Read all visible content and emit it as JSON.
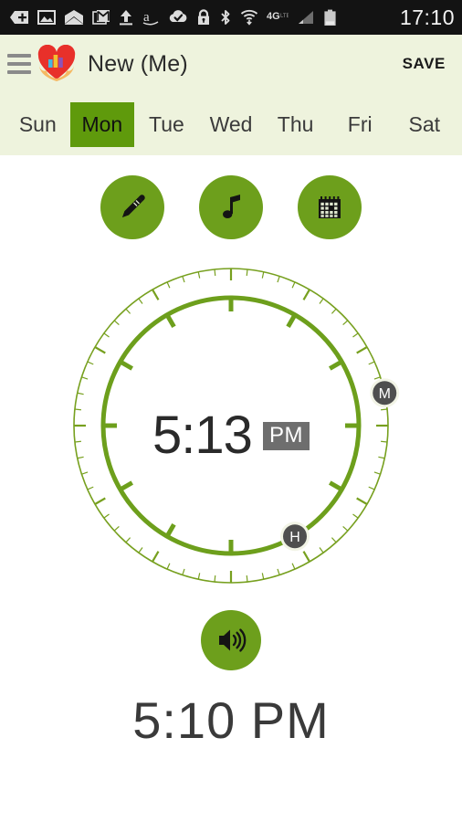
{
  "status_bar": {
    "time": "17:10",
    "network": "4G",
    "icons": [
      "add-tag-icon",
      "photo-icon",
      "envelope-icon",
      "gmail-icon",
      "upload-icon",
      "amazon-icon",
      "cloud-check-icon",
      "lock-icon",
      "bluetooth-icon",
      "wifi-icon",
      "signal-icon",
      "battery-icon"
    ]
  },
  "app_bar": {
    "menu_icon": "hamburger-menu-icon",
    "logo_icon": "heart-hands-logo",
    "title": "New (Me)",
    "save_label": "SAVE"
  },
  "day_tabs": {
    "selected": "Mon",
    "items": [
      {
        "label": "Sun",
        "active": false
      },
      {
        "label": "Mon",
        "active": true
      },
      {
        "label": "Tue",
        "active": false
      },
      {
        "label": "Wed",
        "active": false
      },
      {
        "label": "Thu",
        "active": false
      },
      {
        "label": "Fri",
        "active": false
      },
      {
        "label": "Sat",
        "active": false
      }
    ]
  },
  "quick_actions": [
    {
      "name": "edit-note-button",
      "icon": "pencil-icon"
    },
    {
      "name": "ringtone-button",
      "icon": "music-note-icon"
    },
    {
      "name": "calendar-button",
      "icon": "calendar-icon"
    }
  ],
  "clock": {
    "display_time": "5:13",
    "meridiem": "PM",
    "hour_handle_label": "H",
    "minute_handle_label": "M",
    "hour_value": 5,
    "minute_value": 13,
    "hour_angle_deg": 150,
    "minute_angle_deg": 78
  },
  "footer": {
    "sound_icon": "speaker-volume-icon",
    "alarm_time": "5:10 PM"
  },
  "colors": {
    "accent_green": "#6d9f1c",
    "tab_green": "#5f9a0c",
    "header_bg": "#eef3dd",
    "handle_gray": "#4f4f4f",
    "ampm_badge": "#6e6e6e",
    "status_bg": "#131313"
  }
}
